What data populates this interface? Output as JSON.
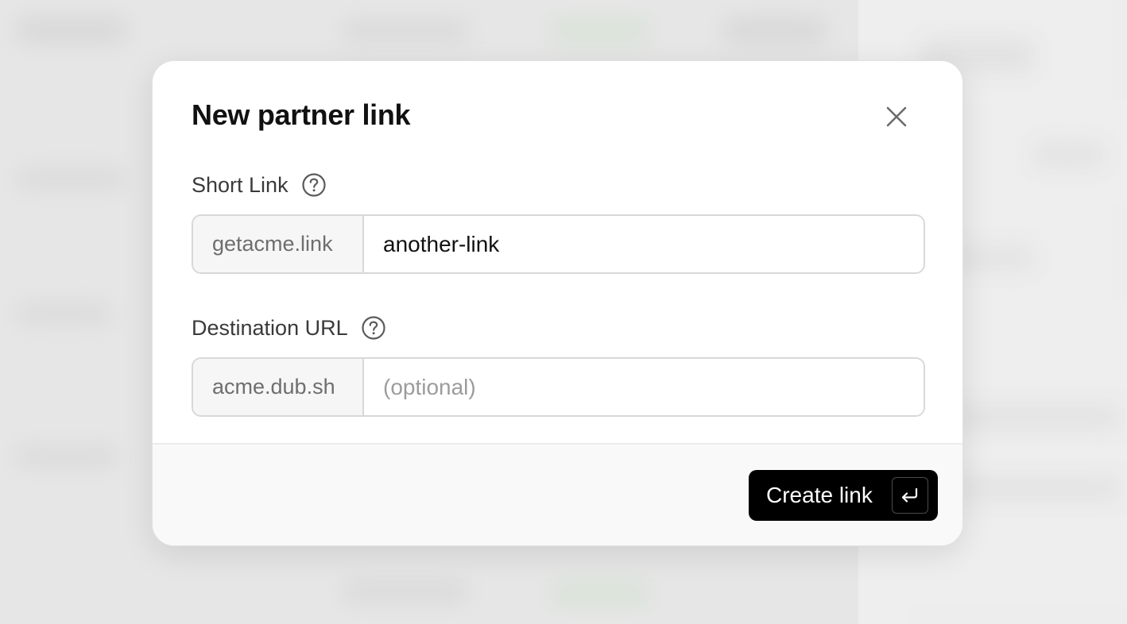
{
  "modal": {
    "title": "New partner link"
  },
  "short_link": {
    "label": "Short Link",
    "prefix": "getacme.link",
    "value": "another-link",
    "placeholder": ""
  },
  "destination_url": {
    "label": "Destination URL",
    "prefix": "acme.dub.sh",
    "value": "",
    "placeholder": "(optional)"
  },
  "footer": {
    "create_label": "Create link"
  },
  "icons": {
    "close": "close-icon",
    "help": "help-circle-icon",
    "enter": "enter-key-icon"
  },
  "colors": {
    "primary_button": "#000000",
    "button_text": "#ffffff",
    "backdrop": "#e9e9e9"
  }
}
